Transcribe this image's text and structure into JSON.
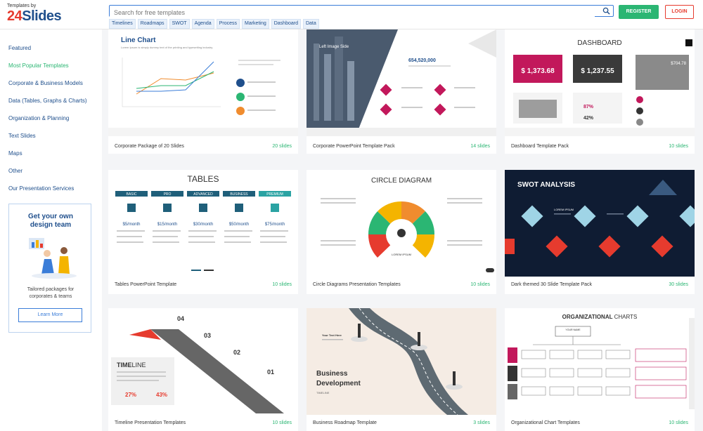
{
  "header": {
    "logo_small": "Templates by",
    "logo_num": "24",
    "logo_text": "Slides",
    "search_placeholder": "Search for free templates",
    "tags": [
      "Timelines",
      "Roadmaps",
      "SWOT",
      "Agenda",
      "Process",
      "Marketing",
      "Dashboard",
      "Data"
    ],
    "register_label": "REGISTER",
    "login_label": "LOGIN"
  },
  "sidebar": {
    "items": [
      {
        "label": "Featured"
      },
      {
        "label": "Most Popular Templates"
      },
      {
        "label": "Corporate & Business Models"
      },
      {
        "label": "Data (Tables, Graphs & Charts)"
      },
      {
        "label": "Organization & Planning"
      },
      {
        "label": "Text Slides"
      },
      {
        "label": "Maps"
      },
      {
        "label": "Other"
      },
      {
        "label": "Our Presentation Services"
      }
    ],
    "promo": {
      "title_line1": "Get your own",
      "title_line2": "design team",
      "text_line1": "Tailored packages for",
      "text_line2": "corporates & teams",
      "button": "Learn More"
    }
  },
  "cards": [
    {
      "title": "Corporate Package of 20 Slides",
      "count": "20 slides",
      "thumb": {
        "heading": "Line Chart",
        "sub": "Lorem Ipsum is simply dummy text of the printing and typesetting industry."
      }
    },
    {
      "title": "Corporate PowerPoint Template Pack",
      "count": "14 slides",
      "thumb": {
        "heading": "Left Image Side",
        "number": "654,520,000"
      }
    },
    {
      "title": "Dashboard Template Pack",
      "count": "10 slides",
      "thumb": {
        "heading": "DASHBOARD",
        "v1": "$ 1,373.68",
        "v2": "$ 1,237.55",
        "v3": "$704.78",
        "p1": "87%",
        "p2": "42%"
      }
    },
    {
      "title": "Tables PowerPoint Template",
      "count": "10 slides",
      "thumb": {
        "heading": "TABLES",
        "cols": [
          "BASIC",
          "PRO",
          "ADVANCED",
          "BUSINESS",
          "PREMIUM"
        ],
        "prices": [
          "$5/month",
          "$15/month",
          "$30/month",
          "$50/month",
          "$75/month"
        ]
      }
    },
    {
      "title": "Circle Diagrams Presentation Templates",
      "count": "10 slides",
      "thumb": {
        "heading": "CIRCLE DIAGRAM",
        "center": "LOREM IPSUM"
      }
    },
    {
      "title": "Dark themed 30 Slide Template Pack",
      "count": "30 slides",
      "thumb": {
        "heading": "SWOT ANALYSIS",
        "label": "LOREM IPSUM"
      }
    },
    {
      "title": "Timeline Presentation Templates",
      "count": "10 slides",
      "thumb": {
        "heading1": "TIME",
        "heading2": "LINE",
        "nums": [
          "04",
          "03",
          "02",
          "01"
        ],
        "p1": "27%",
        "p2": "43%"
      }
    },
    {
      "title": "Business Roadmap Template",
      "count": "3 slides",
      "thumb": {
        "heading1": "Business",
        "heading2": "Development",
        "sub": "TIMELINE",
        "label": "Your Text Here"
      }
    },
    {
      "title": "Organizational Chart Templates",
      "count": "10 slides",
      "thumb": {
        "heading1": "ORGANIZATIONAL",
        "heading2": "CHARTS",
        "top": "YOUR NAME"
      }
    }
  ],
  "colors": {
    "brand_blue": "#1f4f8c",
    "green": "#2bb673",
    "red": "#e63b2e",
    "pink": "#c2185b"
  }
}
